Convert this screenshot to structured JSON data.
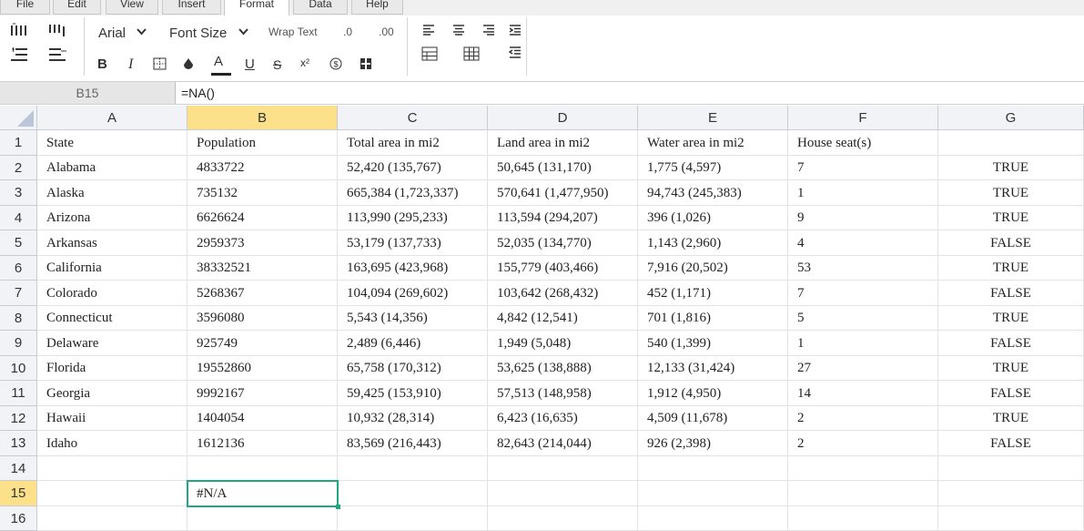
{
  "menu": {
    "tabs": [
      "File",
      "Edit",
      "View",
      "Insert",
      "Format",
      "Data",
      "Help"
    ],
    "active": "Format"
  },
  "toolbar": {
    "font_name": "Arial",
    "font_size": "Font Size",
    "wrap_text": "Wrap Text",
    "decrease_decimal": ".0",
    "increase_decimal": ".00",
    "superscript": "x²"
  },
  "formula_bar": {
    "cell_ref": "B15",
    "formula": "=NA()"
  },
  "columns": [
    "A",
    "B",
    "C",
    "D",
    "E",
    "F",
    "G"
  ],
  "rows": [
    [
      "State",
      "Population",
      "Total area in mi2",
      "Land area in mi2",
      "Water area in mi2",
      "House seat(s)",
      ""
    ],
    [
      "Alabama",
      "4833722",
      "52,420 (135,767)",
      "50,645 (131,170)",
      "1,775 (4,597)",
      "7",
      "TRUE"
    ],
    [
      "Alaska",
      "735132",
      "665,384 (1,723,337)",
      "570,641 (1,477,950)",
      "94,743 (245,383)",
      "1",
      "TRUE"
    ],
    [
      "Arizona",
      "6626624",
      "113,990 (295,233)",
      "113,594 (294,207)",
      "396 (1,026)",
      "9",
      "TRUE"
    ],
    [
      "Arkansas",
      "2959373",
      "53,179 (137,733)",
      "52,035 (134,770)",
      "1,143 (2,960)",
      "4",
      "FALSE"
    ],
    [
      "California",
      "38332521",
      "163,695 (423,968)",
      "155,779 (403,466)",
      "7,916 (20,502)",
      "53",
      "TRUE"
    ],
    [
      "Colorado",
      "5268367",
      "104,094 (269,602)",
      "103,642 (268,432)",
      "452 (1,171)",
      "7",
      "FALSE"
    ],
    [
      "Connecticut",
      "3596080",
      "5,543 (14,356)",
      "4,842 (12,541)",
      "701 (1,816)",
      "5",
      "TRUE"
    ],
    [
      "Delaware",
      "925749",
      "2,489 (6,446)",
      "1,949 (5,048)",
      "540 (1,399)",
      "1",
      "FALSE"
    ],
    [
      "Florida",
      "19552860",
      "65,758 (170,312)",
      "53,625 (138,888)",
      "12,133 (31,424)",
      "27",
      "TRUE"
    ],
    [
      "Georgia",
      "9992167",
      "59,425 (153,910)",
      "57,513 (148,958)",
      "1,912 (4,950)",
      "14",
      "FALSE"
    ],
    [
      "Hawaii",
      "1404054",
      "10,932 (28,314)",
      "6,423 (16,635)",
      "4,509 (11,678)",
      "2",
      "TRUE"
    ],
    [
      "Idaho",
      "1612136",
      "83,569 (216,443)",
      "82,643 (214,044)",
      "926 (2,398)",
      "2",
      "FALSE"
    ],
    [
      "",
      "",
      "",
      "",
      "",
      "",
      ""
    ],
    [
      "",
      "#N/A",
      "",
      "",
      "",
      "",
      ""
    ],
    [
      "",
      "",
      "",
      "",
      "",
      "",
      ""
    ]
  ],
  "selection": {
    "column": "B",
    "row": 15
  },
  "colors": {
    "accent": "#1fa683",
    "selected_header": "#fde08a"
  }
}
